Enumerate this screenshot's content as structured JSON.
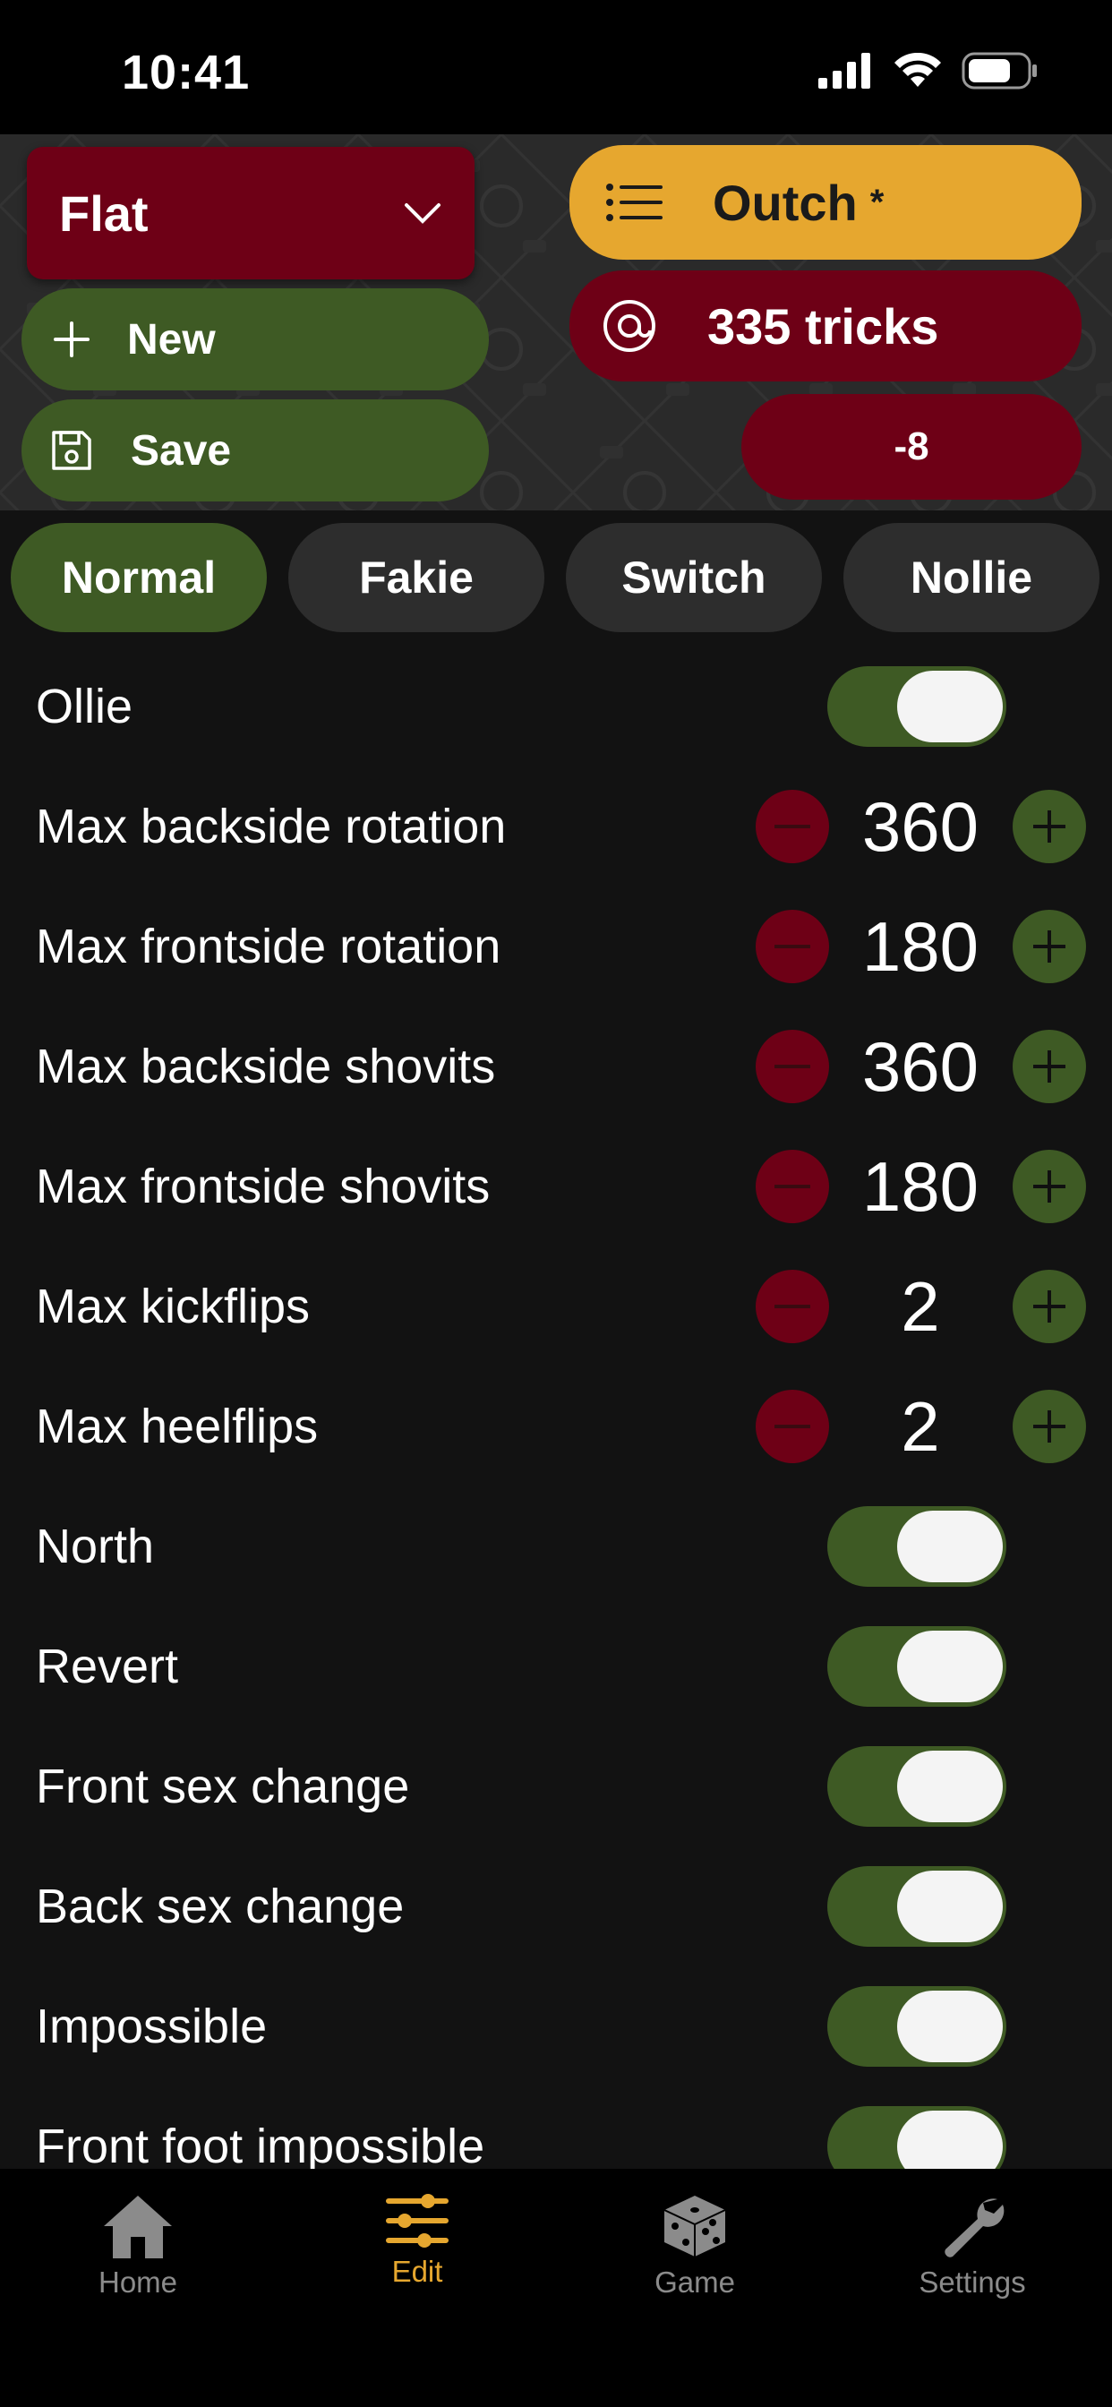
{
  "status_bar": {
    "time": "10:41"
  },
  "header": {
    "profile": "Flat",
    "new_label": "New",
    "save_label": "Save",
    "outch_label": "Outch",
    "outch_star": "*",
    "tricks_count": "335 tricks",
    "score": "-8"
  },
  "tabs": [
    "Normal",
    "Fakie",
    "Switch",
    "Nollie"
  ],
  "settings": [
    {
      "label": "Ollie",
      "type": "toggle",
      "on": true
    },
    {
      "label": "Max backside rotation",
      "type": "stepper",
      "value": "360"
    },
    {
      "label": "Max frontside rotation",
      "type": "stepper",
      "value": "180"
    },
    {
      "label": "Max backside shovits",
      "type": "stepper",
      "value": "360"
    },
    {
      "label": "Max frontside shovits",
      "type": "stepper",
      "value": "180"
    },
    {
      "label": "Max kickflips",
      "type": "stepper",
      "value": "2"
    },
    {
      "label": "Max heelflips",
      "type": "stepper",
      "value": "2"
    },
    {
      "label": "North",
      "type": "toggle",
      "on": true
    },
    {
      "label": "Revert",
      "type": "toggle",
      "on": true
    },
    {
      "label": "Front sex change",
      "type": "toggle",
      "on": true
    },
    {
      "label": "Back sex change",
      "type": "toggle",
      "on": true
    },
    {
      "label": "Impossible",
      "type": "toggle",
      "on": true
    },
    {
      "label": "Front foot impossible",
      "type": "toggle",
      "on": true
    }
  ],
  "tab_bar": [
    {
      "label": "Home",
      "icon": "home-icon",
      "active": false
    },
    {
      "label": "Edit",
      "icon": "sliders-icon",
      "active": true
    },
    {
      "label": "Game",
      "icon": "dice-icon",
      "active": false
    },
    {
      "label": "Settings",
      "icon": "wrench-icon",
      "active": false
    }
  ],
  "colors": {
    "accent": "#e6a72f",
    "green": "#3e5a24",
    "red": "#6e0016",
    "background": "#121212"
  }
}
